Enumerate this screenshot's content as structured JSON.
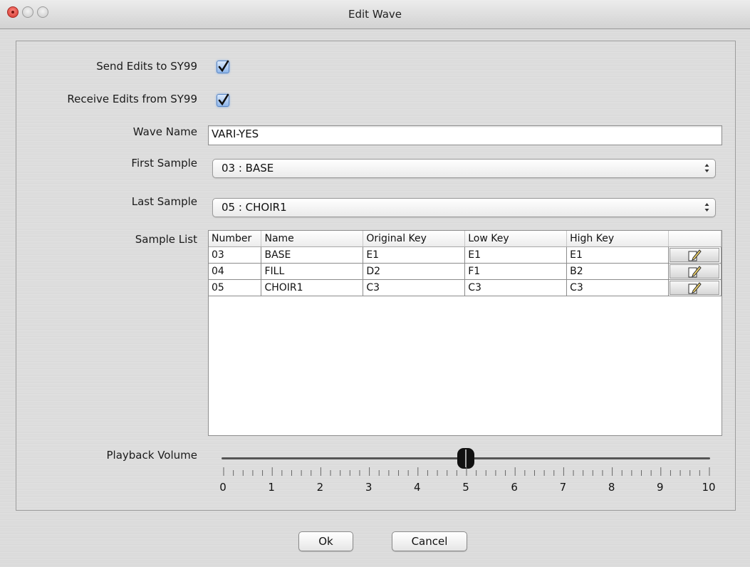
{
  "window": {
    "title": "Edit Wave"
  },
  "form": {
    "send_edits_label": "Send Edits to SY99",
    "send_edits_checked": true,
    "receive_edits_label": "Receive Edits from SY99",
    "receive_edits_checked": true,
    "wave_name_label": "Wave Name",
    "wave_name_value": "VARI-YES",
    "first_sample_label": "First Sample",
    "first_sample_value": "03 : BASE",
    "last_sample_label": "Last Sample",
    "last_sample_value": "05 : CHOIR1",
    "sample_list_label": "Sample List",
    "playback_volume_label": "Playback Volume"
  },
  "sample_table": {
    "columns": [
      "Number",
      "Name",
      "Original Key",
      "Low Key",
      "High Key",
      ""
    ],
    "rows": [
      {
        "number": "03",
        "name": "BASE",
        "original_key": "E1",
        "low_key": "E1",
        "high_key": "E1"
      },
      {
        "number": "04",
        "name": "FILL",
        "original_key": "D2",
        "low_key": "F1",
        "high_key": "B2"
      },
      {
        "number": "05",
        "name": "CHOIR1",
        "original_key": "C3",
        "low_key": "C3",
        "high_key": "C3"
      }
    ]
  },
  "volume_slider": {
    "min": 0,
    "max": 10,
    "value": 5,
    "labels": [
      "0",
      "1",
      "2",
      "3",
      "4",
      "5",
      "6",
      "7",
      "8",
      "9",
      "10"
    ]
  },
  "buttons": {
    "ok_label": "Ok",
    "cancel_label": "Cancel"
  },
  "icons": {
    "edit_row": "edit-pencil-icon",
    "checkbox_check": "checkmark-icon",
    "select_arrows": "updown-arrows-icon"
  }
}
